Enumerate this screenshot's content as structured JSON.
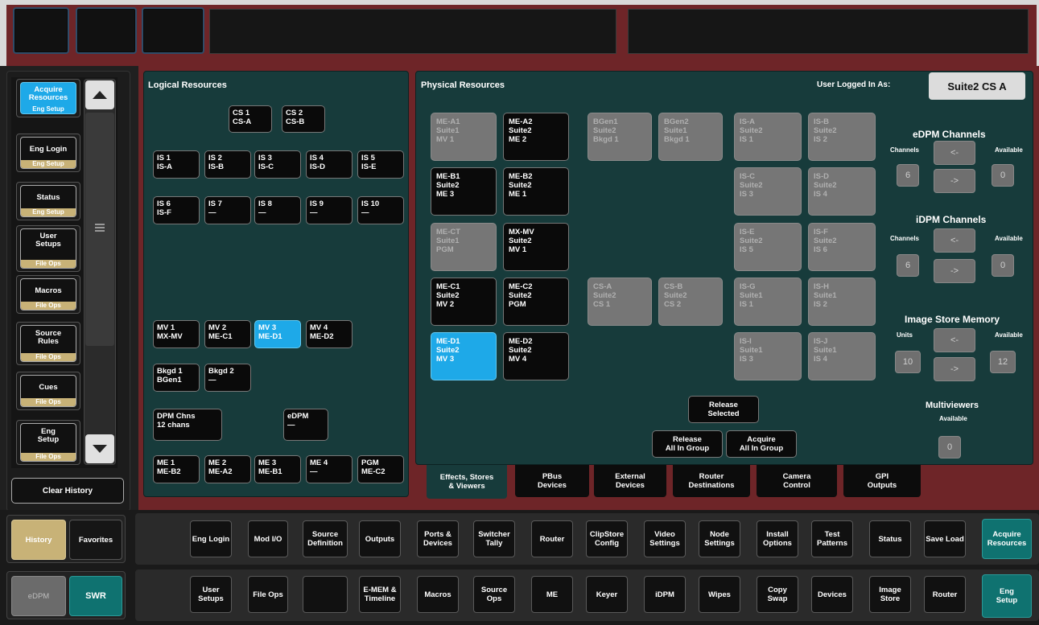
{
  "history": {
    "items": [
      {
        "label": "Acquire\nResources",
        "category": "Eng Setup"
      },
      {
        "label": "Eng Login",
        "category": "Eng Setup"
      },
      {
        "label": "Status",
        "category": "Eng Setup"
      },
      {
        "label": "User\nSetups",
        "category": "File Ops"
      },
      {
        "label": "Macros",
        "category": "File Ops"
      },
      {
        "label": "Source\nRules",
        "category": "File Ops"
      },
      {
        "label": "Cues",
        "category": "File Ops"
      },
      {
        "label": "Eng\nSetup",
        "category": "File Ops"
      }
    ],
    "clear_label": "Clear History"
  },
  "logical": {
    "title": "Logical Resources",
    "buttons": [
      "CS 1\nCS-A",
      "CS 2\nCS-B",
      "IS 1\nIS-A",
      "IS 2\nIS-B",
      "IS 3\nIS-C",
      "IS 4\nIS-D",
      "IS 5\nIS-E",
      "IS 6\nIS-F",
      "IS 7\n—",
      "IS 8\n—",
      "IS 9\n—",
      "IS 10\n—",
      "MV 1\nMX-MV",
      "MV 2\nME-C1",
      "MV 3\nME-D1",
      "MV 4\nME-D2",
      "Bkgd 1\nBGen1",
      "Bkgd 2\n—",
      "DPM Chns\n12 chans",
      "eDPM\n—",
      "ME 1\nME-B2",
      "ME 2\nME-A2",
      "ME 3\nME-B1",
      "ME 4\n—",
      "PGM\nME-C2"
    ]
  },
  "physical": {
    "title": "Physical Resources",
    "user_label": "User Logged In As:",
    "user_value": "Suite2 CS A",
    "buttons": [
      "ME-A1\nSuite1\nMV 1",
      "ME-A2\nSuite2\nME 2",
      "BGen1\nSuite2\nBkgd 1",
      "BGen2\nSuite1\nBkgd 1",
      "IS-A\nSuite2\nIS 1",
      "IS-B\nSuite2\nIS 2",
      "ME-B1\nSuite2\nME 3",
      "ME-B2\nSuite2\nME 1",
      "IS-C\nSuite2\nIS 3",
      "IS-D\nSuite2\nIS 4",
      "ME-CT\nSuite1\nPGM",
      "MX-MV\nSuite2\nMV 1",
      "IS-E\nSuite2\nIS 5",
      "IS-F\nSuite2\nIS 6",
      "ME-C1\nSuite2\nMV 2",
      "ME-C2\nSuite2\nPGM",
      "CS-A\nSuite2\nCS 1",
      "CS-B\nSuite2\nCS 2",
      "IS-G\nSuite1\nIS 1",
      "IS-H\nSuite1\nIS 2",
      "ME-D1\nSuite2\nMV 3",
      "ME-D2\nSuite2\nMV 4",
      "IS-I\nSuite1\nIS 3",
      "IS-J\nSuite1\nIS 4"
    ],
    "release_selected": "Release\nSelected",
    "release_all": "Release\nAll In Group",
    "acquire_all": "Acquire\nAll In Group"
  },
  "edpm": {
    "title": "eDPM Channels",
    "channels_label": "Channels",
    "available_label": "Available",
    "decrease": "<-",
    "increase": "->",
    "channels_value": "6",
    "available_value": "0"
  },
  "idpm": {
    "title": "iDPM Channels",
    "channels_label": "Channels",
    "available_label": "Available",
    "decrease": "<-",
    "increase": "->",
    "channels_value": "6",
    "available_value": "0"
  },
  "image_store": {
    "title": "Image Store Memory",
    "units_label": "Units",
    "available_label": "Available",
    "decrease": "<-",
    "increase": "->",
    "units_value": "10",
    "available_value": "12"
  },
  "multiviewers": {
    "title": "Multiviewers",
    "available_label": "Available",
    "available_value": "0"
  },
  "tabs": [
    "Effects, Stores\n& Viewers",
    "PBus\nDevices",
    "External\nDevices",
    "Router\nDestinations",
    "Camera\nControl",
    "GPI\nOutputs"
  ],
  "mode": {
    "history": "History",
    "favorites": "Favorites",
    "edpm": "eDPM",
    "swr": "SWR"
  },
  "nav_row1": [
    "Eng Login",
    "Mod I/O",
    "Source\nDefinition",
    "Outputs",
    "Ports &\nDevices",
    "Switcher\nTally",
    "Router",
    "ClipStore\nConfig",
    "Video\nSettings",
    "Node\nSettings",
    "Install\nOptions",
    "Test\nPatterns",
    "Status",
    "Save Load",
    "Acquire\nResources"
  ],
  "nav_row2": [
    "User\nSetups",
    "File Ops",
    "",
    "E-MEM &\nTimeline",
    "Macros",
    "Source\nOps",
    "ME",
    "Keyer",
    "iDPM",
    "Wipes",
    "Copy\nSwap",
    "Devices",
    "Image\nStore",
    "Router",
    "Eng\nSetup"
  ],
  "colors": {
    "panel_bg": "#173b3b",
    "frame_red": "#6e2528",
    "selected_blue": "#1ea9e8",
    "active_teal": "#0f7270",
    "category_tan": "#c8b277"
  }
}
